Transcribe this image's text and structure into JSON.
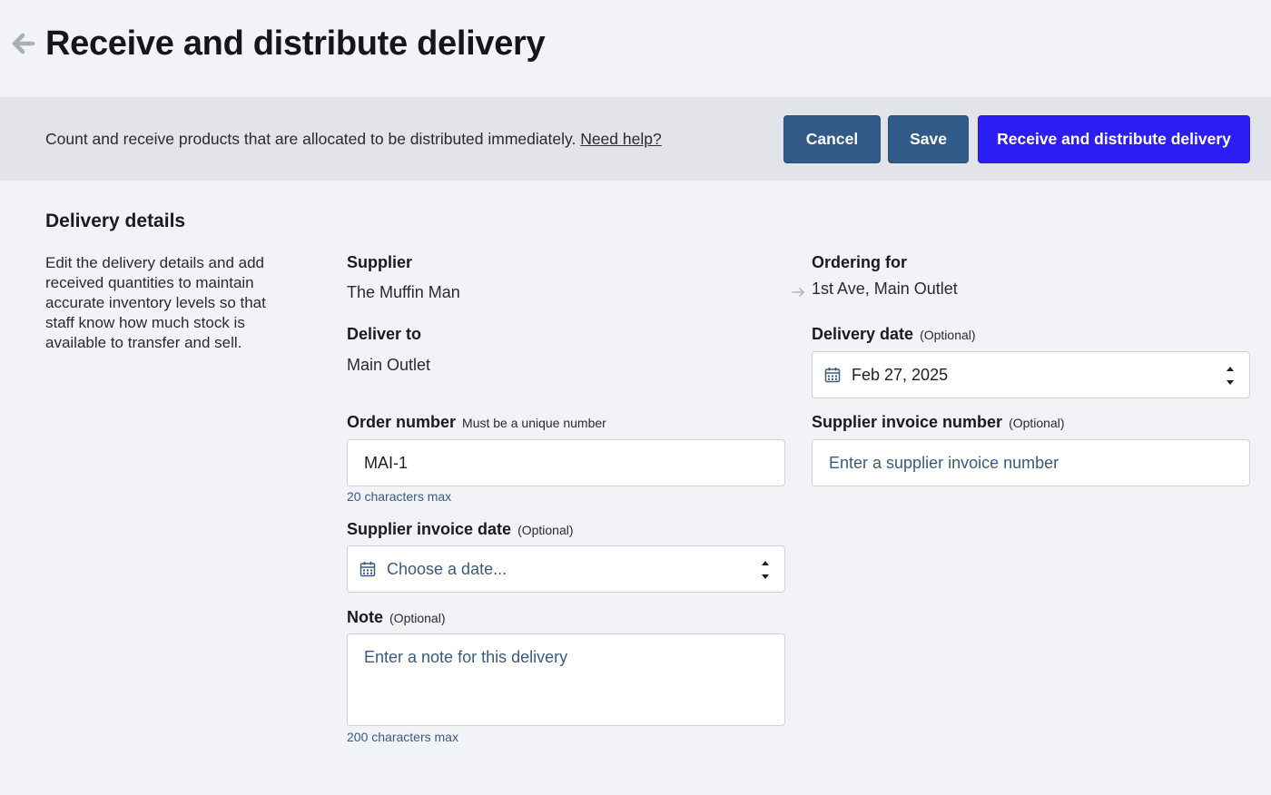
{
  "header": {
    "title": "Receive and distribute delivery",
    "back_icon": "arrow-left-icon"
  },
  "action_bar": {
    "description": "Count and receive products that are allocated to be distributed immediately.",
    "help_link": "Need help?",
    "cancel_label": "Cancel",
    "save_label": "Save",
    "primary_label": "Receive and distribute delivery"
  },
  "details": {
    "title": "Delivery details",
    "description": "Edit the delivery details and add received quantities to maintain accurate inventory levels so that staff know how much stock is available to transfer and sell."
  },
  "form": {
    "supplier": {
      "label": "Supplier",
      "value": "The Muffin Man"
    },
    "ordering_for": {
      "label": "Ordering for",
      "value": "1st Ave, Main Outlet"
    },
    "deliver_to": {
      "label": "Deliver to",
      "value": "Main Outlet"
    },
    "delivery_date": {
      "label": "Delivery date",
      "hint": "(Optional)",
      "value": "Feb 27, 2025"
    },
    "order_number": {
      "label": "Order number",
      "hint": "Must be a unique number",
      "value": "MAI-1",
      "helper": "20 characters max"
    },
    "supplier_invoice_number": {
      "label": "Supplier invoice number",
      "hint": "(Optional)",
      "placeholder": "Enter a supplier invoice number"
    },
    "supplier_invoice_date": {
      "label": "Supplier invoice date",
      "hint": "(Optional)",
      "placeholder": "Choose a date..."
    },
    "note": {
      "label": "Note",
      "hint": "(Optional)",
      "placeholder": "Enter a note for this delivery",
      "helper": "200 characters max"
    }
  },
  "colors": {
    "page_bg": "#f1f3f7",
    "action_bar_bg": "#e2e4e9",
    "secondary_button": "#325a88",
    "primary_button": "#2d1df5",
    "placeholder_text": "#3b5a7e"
  }
}
